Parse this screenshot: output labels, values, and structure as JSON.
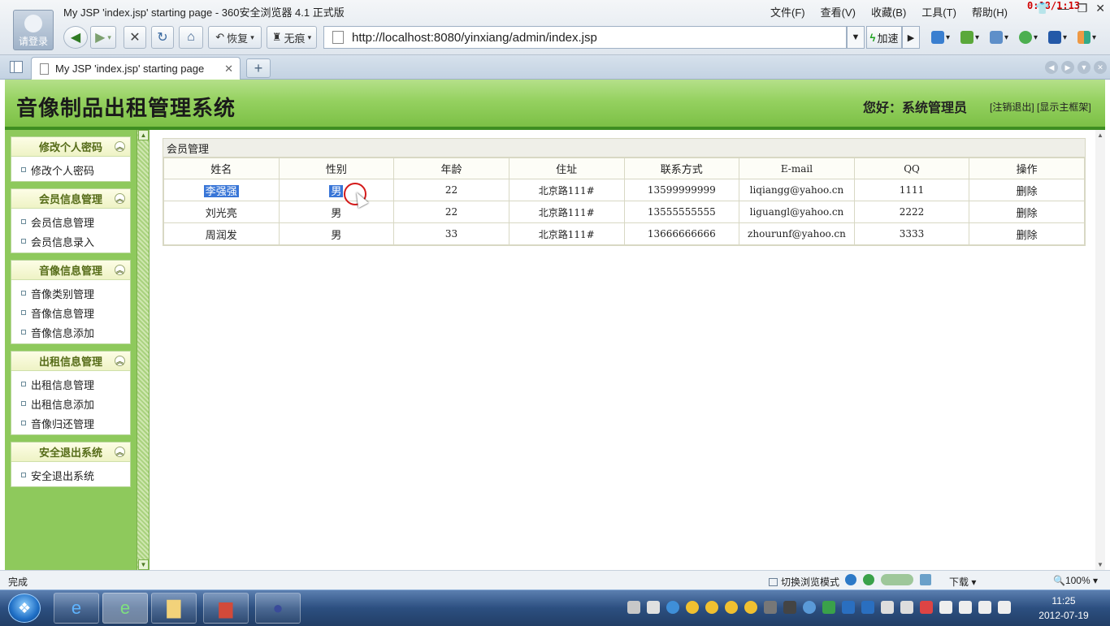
{
  "window": {
    "login_label": "请登录",
    "title": "My JSP 'index.jsp' starting page - 360安全浏览器 4.1 正式版",
    "menus": [
      "文件(F)",
      "查看(V)",
      "收藏(B)",
      "工具(T)",
      "帮助(H)"
    ],
    "recording_timer": "0:18/1:13"
  },
  "toolbar": {
    "restore_label": "恢复",
    "incognito_label": "无痕",
    "url": "http://localhost:8080/yinxiang/admin/index.jsp",
    "speed_label": "加速"
  },
  "tab": {
    "title": "My JSP 'index.jsp' starting page"
  },
  "app": {
    "title": "音像制品出租管理系统",
    "greeting": "您好：系统管理员",
    "header_links": "[注销退出] [显示主框架]"
  },
  "menu": [
    {
      "header": "修改个人密码",
      "items": [
        "修改个人密码"
      ]
    },
    {
      "header": "会员信息管理",
      "items": [
        "会员信息管理",
        "会员信息录入"
      ]
    },
    {
      "header": "音像信息管理",
      "items": [
        "音像类别管理",
        "音像信息管理",
        "音像信息添加"
      ]
    },
    {
      "header": "出租信息管理",
      "items": [
        "出租信息管理",
        "出租信息添加",
        "音像归还管理"
      ]
    },
    {
      "header": "安全退出系统",
      "items": [
        "安全退出系统"
      ]
    }
  ],
  "panel": {
    "title": "会员管理",
    "columns": [
      "姓名",
      "性别",
      "年龄",
      "住址",
      "联系方式",
      "E-mail",
      "QQ",
      "操作"
    ],
    "rows": [
      [
        "李强强",
        "男",
        "22",
        "北京路111#",
        "13599999999",
        "liqiangg@yahoo.cn",
        "1111",
        "删除"
      ],
      [
        "刘光亮",
        "男",
        "22",
        "北京路111#",
        "13555555555",
        "liguangl@yahoo.cn",
        "2222",
        "删除"
      ],
      [
        "周润发",
        "男",
        "33",
        "北京路111#",
        "13666666666",
        "zhourunf@yahoo.cn",
        "3333",
        "删除"
      ]
    ]
  },
  "status": {
    "text": "完成",
    "mode_switch": "切换浏览模式",
    "download": "下载",
    "zoom": "100%"
  },
  "clock": {
    "time": "11:25",
    "date": "2012-07-19"
  }
}
